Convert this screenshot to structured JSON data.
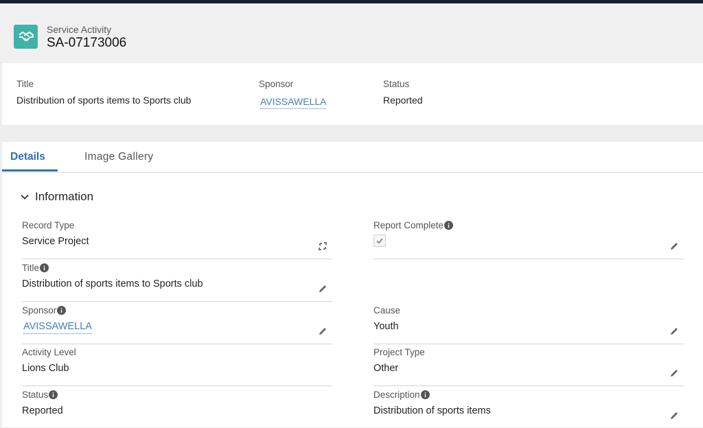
{
  "header": {
    "object_type": "Service Activity",
    "record_name": "SA-07173006",
    "icon": "handshake-icon",
    "icon_color": "#3fb3a8"
  },
  "highlights": {
    "title_label": "Title",
    "title_value": "Distribution of sports items to Sports club",
    "sponsor_label": "Sponsor",
    "sponsor_value": "AVISSAWELLA",
    "status_label": "Status",
    "status_value": "Reported"
  },
  "tabs": [
    {
      "label": "Details",
      "active": true
    },
    {
      "label": "Image Gallery",
      "active": false
    }
  ],
  "section": {
    "title": "Information",
    "expanded": true
  },
  "fields": {
    "record_type": {
      "label": "Record Type",
      "value": "Service Project"
    },
    "report_complete": {
      "label": "Report Complete",
      "checked": true
    },
    "title": {
      "label": "Title",
      "value": "Distribution of sports items to Sports club"
    },
    "sponsor": {
      "label": "Sponsor",
      "value": "AVISSAWELLA"
    },
    "cause": {
      "label": "Cause",
      "value": "Youth"
    },
    "activity_level": {
      "label": "Activity Level",
      "value": "Lions Club"
    },
    "project_type": {
      "label": "Project Type",
      "value": "Other"
    },
    "status": {
      "label": "Status",
      "value": "Reported"
    },
    "description": {
      "label": "Description",
      "value": "Distribution of sports items"
    }
  },
  "colors": {
    "accent": "#2f6fb4",
    "link": "#3f7fbf",
    "top_bar": "#152033"
  }
}
